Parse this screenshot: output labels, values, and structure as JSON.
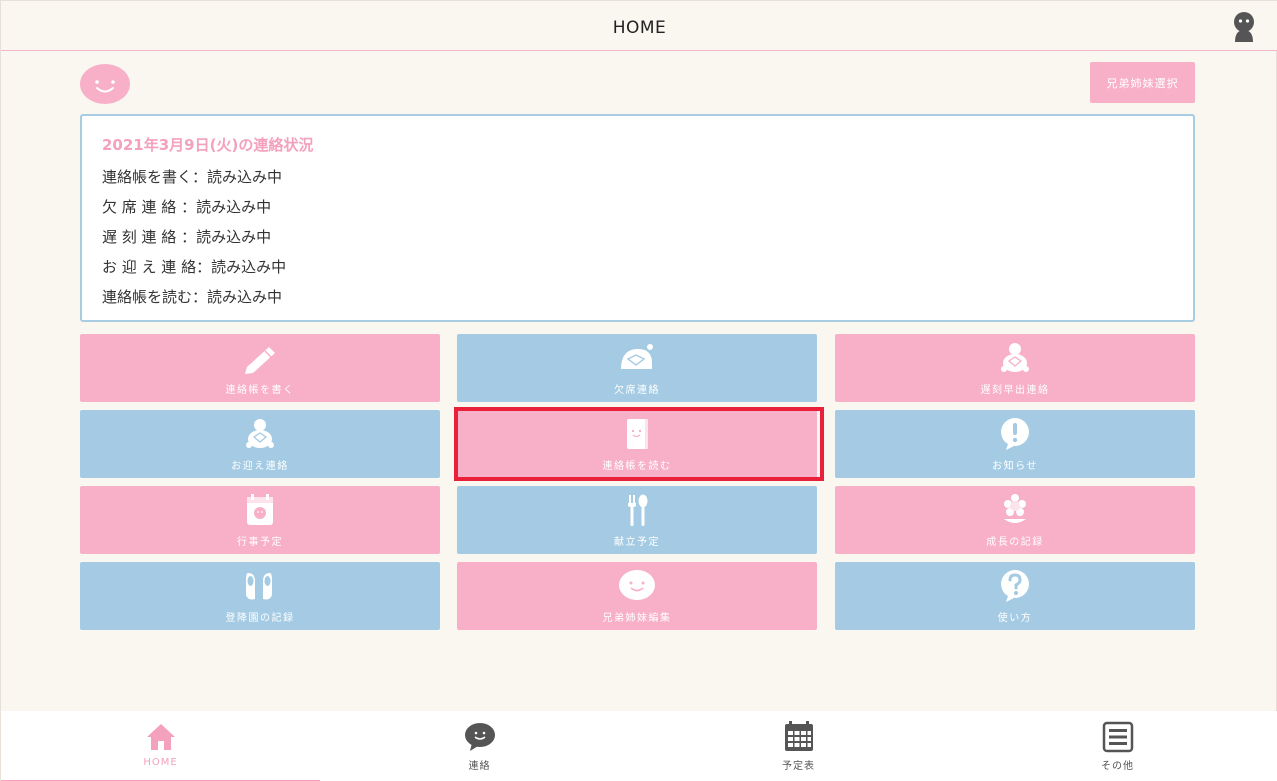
{
  "header": {
    "title": "HOME",
    "account_icon": "user-silhouette-icon"
  },
  "top": {
    "face_icon": "smiley-face-icon",
    "sibling_select_label": "兄弟姉妹選択"
  },
  "status": {
    "title": "2021年3月9日(火)の連絡状況",
    "rows": [
      "連絡帳を書く：読み込み中",
      "欠 席 連 絡 ：読み込み中",
      "遅 刻 連 絡 ：読み込み中",
      "お 迎 え 連 絡：読み込み中",
      "連絡帳を読む：読み込み中"
    ]
  },
  "menu": {
    "tiles": [
      {
        "label": "連絡帳を書く",
        "icon": "pencil-icon",
        "color": "#f7b0c8"
      },
      {
        "label": "欠席連絡",
        "icon": "turtle-shell-icon",
        "color": "#a4cbe3"
      },
      {
        "label": "遅刻早出連絡",
        "icon": "turtle-icon",
        "color": "#f7b0c8"
      },
      {
        "label": "お迎え連絡",
        "icon": "turtle-icon",
        "color": "#a4cbe3"
      },
      {
        "label": "連絡帳を読む",
        "icon": "notebook-icon",
        "color": "#f7b0c8"
      },
      {
        "label": "お知らせ",
        "icon": "exclamation-icon",
        "color": "#a4cbe3"
      },
      {
        "label": "行事予定",
        "icon": "calendar-icon",
        "color": "#f7b0c8"
      },
      {
        "label": "献立予定",
        "icon": "fork-spoon-icon",
        "color": "#a4cbe3"
      },
      {
        "label": "成長の記録",
        "icon": "flower-icon",
        "color": "#f7b0c8"
      },
      {
        "label": "登降園の記録",
        "icon": "shoes-icon",
        "color": "#a4cbe3"
      },
      {
        "label": "兄弟姉妹編集",
        "icon": "smiley-face-icon",
        "color": "#f7b0c8"
      },
      {
        "label": "使い方",
        "icon": "question-icon",
        "color": "#a4cbe3"
      }
    ]
  },
  "tabbar": {
    "tabs": [
      {
        "label": "HOME",
        "icon": "home-icon",
        "active": true
      },
      {
        "label": "連絡",
        "icon": "chat-bubble-icon",
        "active": false
      },
      {
        "label": "予定表",
        "icon": "calendar-grid-icon",
        "active": false
      },
      {
        "label": "その他",
        "icon": "list-menu-icon",
        "active": false
      }
    ]
  },
  "colors": {
    "pink": "#f7b0c8",
    "blue": "#a4cbe3",
    "highlight": "#e8203a",
    "background": "#faf6f0"
  }
}
